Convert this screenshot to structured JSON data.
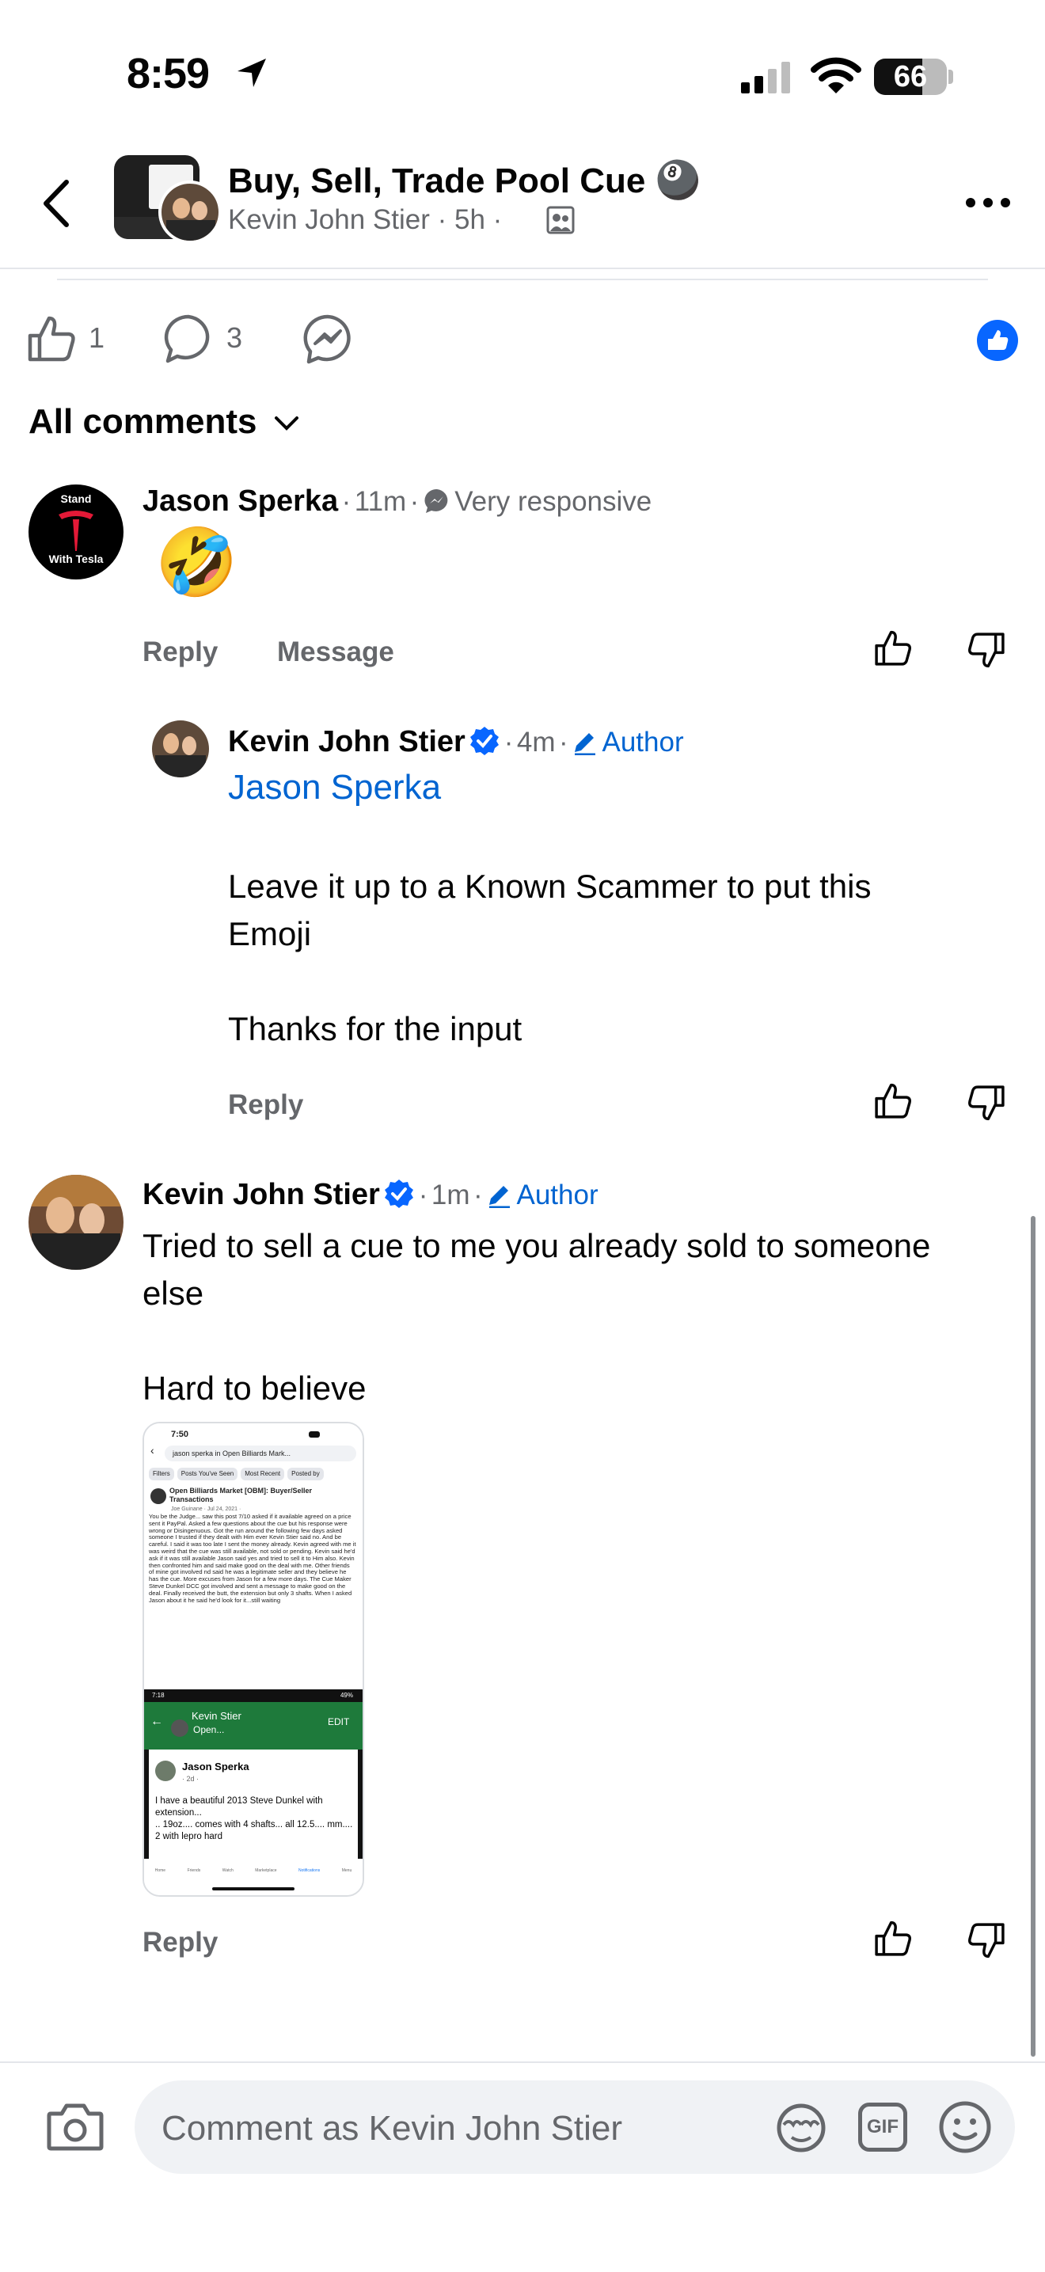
{
  "status_bar": {
    "time": "8:59",
    "battery_level": "66",
    "battery_fraction": 0.66
  },
  "header": {
    "group_title": "Buy, Sell, Trade Pool Cue",
    "title_emoji": "🎱",
    "author": "Kevin John Stier",
    "separator": "·",
    "age": "5h"
  },
  "reactions": {
    "like_count": "1",
    "comment_count": "3"
  },
  "comments_filter": {
    "label": "All comments"
  },
  "comments": [
    {
      "name": "Jason Sperka",
      "avatar_text_top": "Stand",
      "avatar_text_bottom": "With Tesla",
      "time": "11m",
      "badge": "Very responsive",
      "emoji": "🤣",
      "reply_label": "Reply",
      "message_label": "Message"
    },
    {
      "name": "Kevin John Stier",
      "time": "4m",
      "author_label": "Author",
      "mention": "Jason Sperka",
      "text": "Leave it up to a Known Scammer to put this\nEmoji\n\nThanks for the input",
      "reply_label": "Reply"
    },
    {
      "name": "Kevin John Stier",
      "time": "1m",
      "author_label": "Author",
      "text": "Tried to sell a cue to me you already sold to someone\nelse\n\nHard to believe",
      "reply_label": "Reply",
      "attachment": {
        "time": "7:50",
        "search": "jason sperka in Open Billiards Mark...",
        "chips": [
          "Filters",
          "Posts You've Seen",
          "Most Recent",
          "Posted by"
        ],
        "group": "Open Billiards Market [OBM]: Buyer/Seller Transactions",
        "poster": "Joe Guinane · Jul 24, 2021 · ",
        "post_text": "You be the Judge... saw this post 7/10 asked if it available agreed on a price sent it PayPal. Asked a few questions about the cue but his response were wrong or Disingenuous. Got the run around the following few days asked someone I trusted if they dealt with Him ever Kevin Stier said no. And be careful. I said it was too late I sent the money already. Kevin agreed with me it was weird that the cue was still available, not sold or pending. Kevin said he'd ask if it was still available Jason said yes and tried to sell it to Him also. Kevin then confronted him and said make good on the deal with me. Other friends of mine got involved nd said he was a legitimate seller and they believe he has the cue. More excuses from Jason for a few more days. The Cue Maker Steve Dunkel DCC got involved and sent a message to make good on the deal. Finally received the butt, the extension but only 3 shafts. When I asked Jason about it he said he'd look for it...still waiting",
        "inner_time": "7:18",
        "inner_battery": "49%",
        "inner_bar_title": "Kevin Stier",
        "inner_bar_sub": "Open...",
        "inner_edit": "EDIT",
        "inner_poster": "Jason Sperka",
        "inner_meta": "· 2d · ",
        "inner_text": "I have a beautiful 2013 Steve Dunkel with extension...\n.. 19oz.... comes with 4 shafts... all 12.5.... mm.... 2 with lepro hard",
        "tabs": [
          "Home",
          "Friends",
          "Watch",
          "Marketplace",
          "Notifications",
          "Menu"
        ]
      }
    }
  ],
  "composer": {
    "placeholder": "Comment as Kevin John Stier",
    "gif_label": "GIF"
  },
  "colors": {
    "blue": "#0866ff",
    "link": "#0064d1",
    "gray": "#65676b"
  }
}
